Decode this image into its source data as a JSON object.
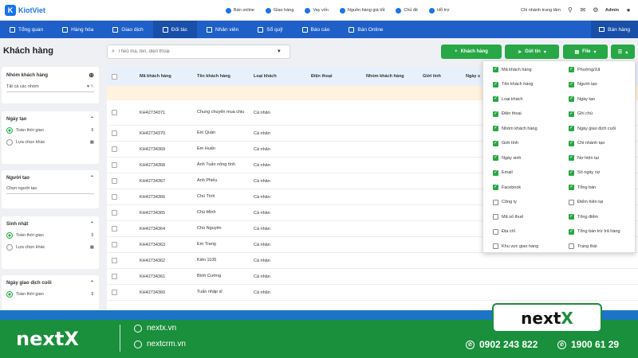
{
  "app": {
    "name": "KiotViet",
    "logo_letter": "K"
  },
  "topnav": [
    {
      "label": "Bán online",
      "icon": "shop-icon"
    },
    {
      "label": "Giao hàng",
      "icon": "truck-icon"
    },
    {
      "label": "Vay vốn",
      "icon": "money-bag-icon"
    },
    {
      "label": "Nguồn hàng giá tốt",
      "icon": "handshake-icon"
    },
    {
      "label": "Chủ đề",
      "icon": "palette-icon"
    },
    {
      "label": "Hỗ trợ",
      "icon": "headset-icon"
    }
  ],
  "topright": {
    "branch": "Chi nhánh trung tâm",
    "user": "Admin"
  },
  "mainnav": [
    {
      "label": "Tổng quan",
      "icon": "eye-icon"
    },
    {
      "label": "Hàng hóa",
      "icon": "box-icon"
    },
    {
      "label": "Giao dịch",
      "icon": "exchange-icon"
    },
    {
      "label": "Đối tác",
      "icon": "user-icon",
      "active": true
    },
    {
      "label": "Nhân viên",
      "icon": "users-icon"
    },
    {
      "label": "Sổ quỹ",
      "icon": "wallet-icon"
    },
    {
      "label": "Báo cáo",
      "icon": "report-icon"
    },
    {
      "label": "Bán Online",
      "icon": "cart-icon"
    }
  ],
  "sell_button": "Bán hàng",
  "page_title": "Khách hàng",
  "search": {
    "placeholder": "Theo mã, tên, điện thoại",
    "value": ""
  },
  "buttons": {
    "add": "Khách hàng",
    "send": "Gửi tin",
    "file": "File"
  },
  "sidebar": {
    "group": {
      "title": "Nhóm khách hàng",
      "value": "Tất cả các nhóm"
    },
    "created": {
      "title": "Ngày tạo",
      "opt_all": "Toàn thời gian",
      "opt_custom": "Lựa chọn khác"
    },
    "creator": {
      "title": "Người tạo",
      "placeholder": "Chọn người tạo"
    },
    "birthday": {
      "title": "Sinh nhật",
      "opt_all": "Toàn thời gian",
      "opt_custom": "Lựa chọn khác"
    },
    "last_trade": {
      "title": "Ngày giao dịch cuối",
      "opt_all": "Toàn thời gian"
    }
  },
  "table": {
    "headers": [
      "Mã khách hàng",
      "Tên khách hàng",
      "Loại khách",
      "Điện thoại",
      "Nhóm khách hàng",
      "Giới tính",
      "Ngày s"
    ],
    "rows": [
      {
        "code": "KH42734371",
        "name": "Chung chuyển mua chịu",
        "type": "Cá nhân"
      },
      {
        "code": "KH42734370",
        "name": "Em Quân",
        "type": "Cá nhân"
      },
      {
        "code": "KH42734369",
        "name": "Em Huấn",
        "type": "Cá nhân"
      },
      {
        "code": "KH42734368",
        "name": "Anh Tuấn nông tình",
        "type": "Cá nhân"
      },
      {
        "code": "KH42734367",
        "name": "Anh Phiếu",
        "type": "Cá nhân"
      },
      {
        "code": "KH42734366",
        "name": "Chú Tính",
        "type": "Cá nhân"
      },
      {
        "code": "KH42734365",
        "name": "Chú Minh",
        "type": "Cá nhân"
      },
      {
        "code": "KH42734364",
        "name": "Chú Nguyên",
        "type": "Cá nhân"
      },
      {
        "code": "KH42734363",
        "name": "Em Trang",
        "type": "Cá nhân"
      },
      {
        "code": "KH42734362",
        "name": "Kiên 1105",
        "type": "Cá nhân"
      },
      {
        "code": "KH42734361",
        "name": "Bình Cường",
        "type": "Cá nhân"
      },
      {
        "code": "KH42734360",
        "name": "Tuấn nhập sỉ",
        "type": "Cá nhân"
      }
    ]
  },
  "columns_left": [
    {
      "label": "Mã khách hàng",
      "checked": true
    },
    {
      "label": "Tên khách hàng",
      "checked": true
    },
    {
      "label": "Loại khách",
      "checked": true
    },
    {
      "label": "Điện thoại",
      "checked": true
    },
    {
      "label": "Nhóm khách hàng",
      "checked": true
    },
    {
      "label": "Giới tính",
      "checked": true
    },
    {
      "label": "Ngày sinh",
      "checked": true
    },
    {
      "label": "Email",
      "checked": true
    },
    {
      "label": "Facebook",
      "checked": true
    },
    {
      "label": "Công ty",
      "checked": false
    },
    {
      "label": "Mã số thuế",
      "checked": false
    },
    {
      "label": "Địa chỉ",
      "checked": false
    },
    {
      "label": "Khu vực giao hàng",
      "checked": false
    }
  ],
  "columns_right": [
    {
      "label": "Phường/Xã",
      "checked": true
    },
    {
      "label": "Người tạo",
      "checked": true
    },
    {
      "label": "Ngày tạo",
      "checked": true
    },
    {
      "label": "Ghi chú",
      "checked": true
    },
    {
      "label": "Ngày giao dịch cuối",
      "checked": true
    },
    {
      "label": "Chi nhánh tạo",
      "checked": true
    },
    {
      "label": "Nợ hiện tại",
      "checked": true
    },
    {
      "label": "Số ngày nợ",
      "checked": true
    },
    {
      "label": "Tổng bán",
      "checked": true
    },
    {
      "label": "Điểm hiện tại",
      "checked": false
    },
    {
      "label": "Tổng điểm",
      "checked": true
    },
    {
      "label": "Tổng bán trừ trả hàng",
      "checked": true
    },
    {
      "label": "Trạng thái",
      "checked": false
    }
  ],
  "footer": {
    "brand": "nextX",
    "site1": "nextx.vn",
    "site2": "nextcrm.vn",
    "phone1": "0902 243 822",
    "phone2": "1900 61 29",
    "badge_prefix": "next",
    "badge_x": "X"
  }
}
